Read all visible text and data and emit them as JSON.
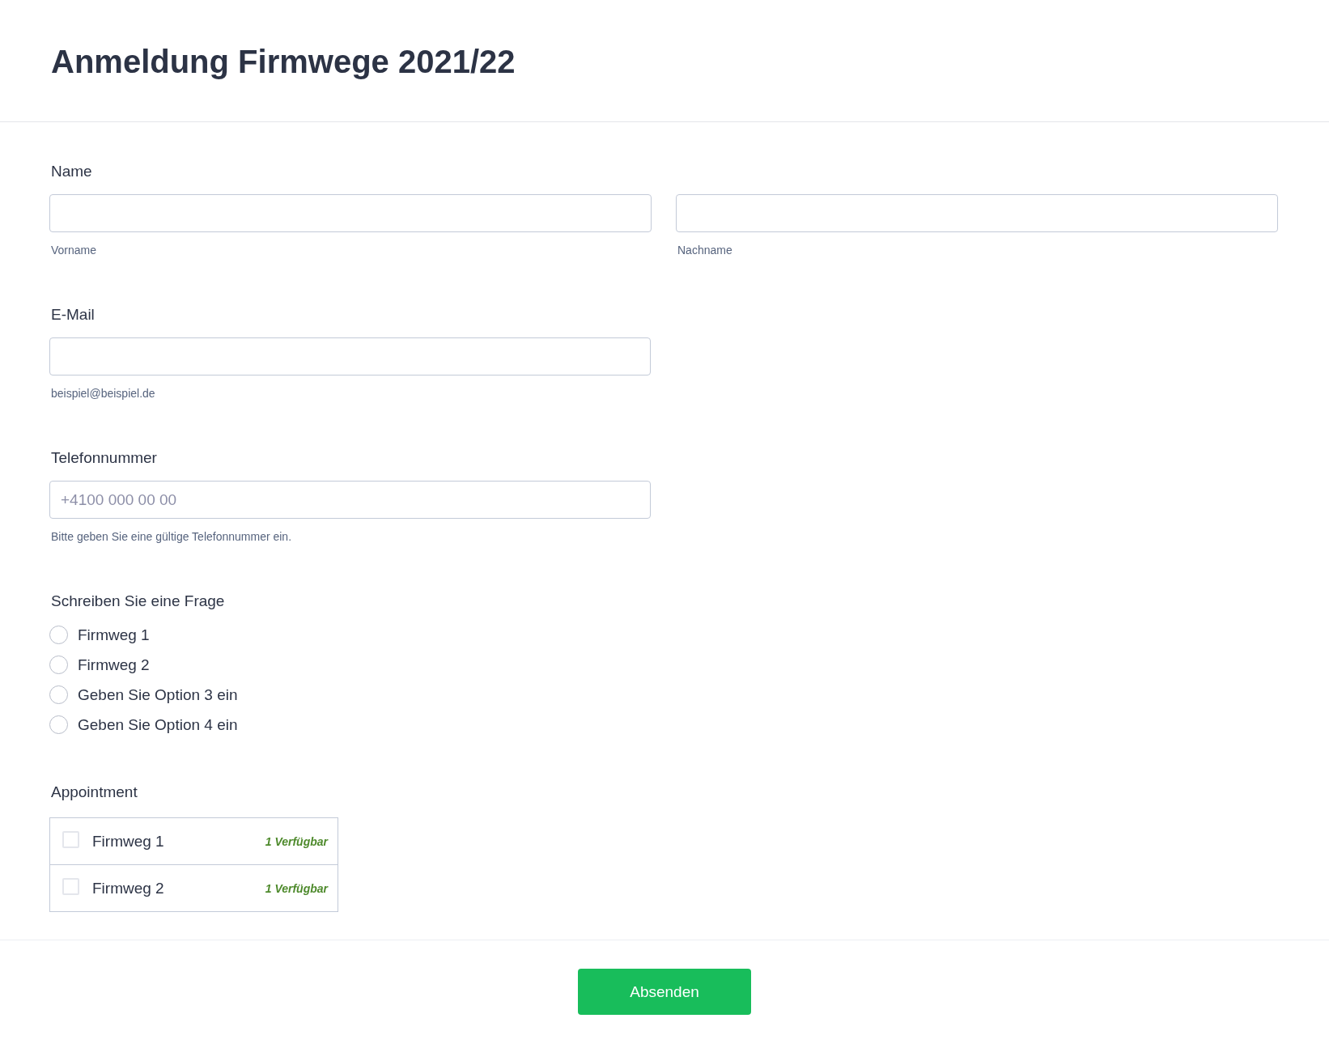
{
  "title": "Anmeldung Firmwege 2021/22",
  "name": {
    "label": "Name",
    "fields": [
      {
        "sublabel": "Vorname"
      },
      {
        "sublabel": "Nachname"
      }
    ]
  },
  "email": {
    "label": "E-Mail",
    "sublabel": "beispiel@beispiel.de"
  },
  "phone": {
    "label": "Telefonnummer",
    "placeholder": "+4100 000 00 00",
    "sublabel": "Bitte geben Sie eine gültige Telefonnummer ein."
  },
  "question": {
    "label": "Schreiben Sie eine Frage",
    "options": [
      {
        "label": "Firmweg 1",
        "selected": false
      },
      {
        "label": "Firmweg 2",
        "selected": false
      },
      {
        "label": "Geben Sie Option 3 ein",
        "selected": false
      },
      {
        "label": "Geben Sie Option 4 ein",
        "selected": false
      }
    ]
  },
  "appointment": {
    "label": "Appointment",
    "slots": [
      {
        "label": "Firmweg 1",
        "availability": "1 Verfügbar",
        "checked": false
      },
      {
        "label": "Firmweg 2",
        "availability": "1 Verfügbar",
        "checked": false
      }
    ]
  },
  "submit": "Absenden"
}
